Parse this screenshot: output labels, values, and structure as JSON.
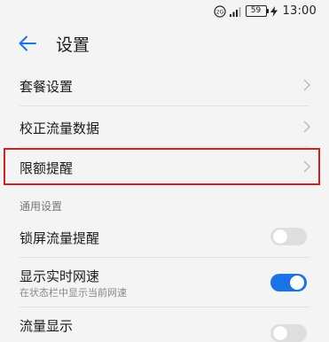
{
  "status_bar": {
    "network_label": "2G",
    "battery": "59",
    "time": "13:00"
  },
  "header": {
    "title": "设置"
  },
  "items": {
    "plan_settings": "套餐设置",
    "calibrate_data": "校正流量数据",
    "limit_reminder": "限额提醒"
  },
  "general_section": {
    "title": "通用设置",
    "lock_screen_reminder": {
      "label": "锁屏流量提醒",
      "on": false
    },
    "realtime_speed": {
      "label": "显示实时网速",
      "sublabel": "在状态栏中显示当前网速",
      "on": true
    },
    "traffic_display": {
      "label": "流量显示"
    }
  },
  "colors": {
    "accent": "#1a73e8",
    "highlight": "#d0211c"
  }
}
